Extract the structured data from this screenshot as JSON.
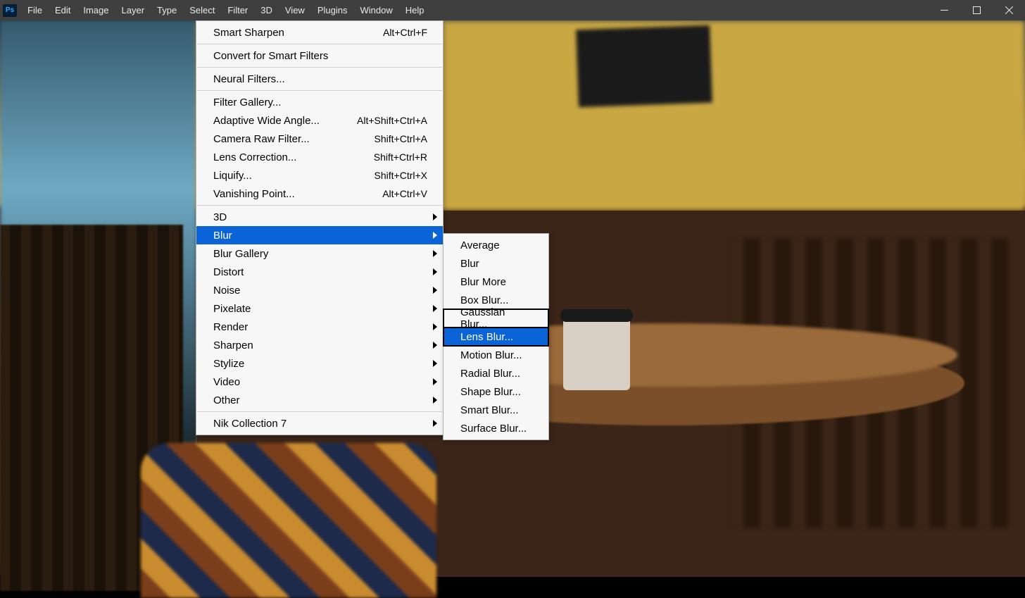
{
  "app_logo": "Ps",
  "menubar": [
    "File",
    "Edit",
    "Image",
    "Layer",
    "Type",
    "Select",
    "Filter",
    "3D",
    "View",
    "Plugins",
    "Window",
    "Help"
  ],
  "filter_menu": {
    "groups": [
      [
        {
          "label": "Smart Sharpen",
          "shortcut": "Alt+Ctrl+F",
          "arrow": false
        }
      ],
      [
        {
          "label": "Convert for Smart Filters",
          "shortcut": "",
          "arrow": false
        }
      ],
      [
        {
          "label": "Neural Filters...",
          "shortcut": "",
          "arrow": false
        }
      ],
      [
        {
          "label": "Filter Gallery...",
          "shortcut": "",
          "arrow": false
        },
        {
          "label": "Adaptive Wide Angle...",
          "shortcut": "Alt+Shift+Ctrl+A",
          "arrow": false
        },
        {
          "label": "Camera Raw Filter...",
          "shortcut": "Shift+Ctrl+A",
          "arrow": false
        },
        {
          "label": "Lens Correction...",
          "shortcut": "Shift+Ctrl+R",
          "arrow": false
        },
        {
          "label": "Liquify...",
          "shortcut": "Shift+Ctrl+X",
          "arrow": false
        },
        {
          "label": "Vanishing Point...",
          "shortcut": "Alt+Ctrl+V",
          "arrow": false
        }
      ],
      [
        {
          "label": "3D",
          "shortcut": "",
          "arrow": true
        },
        {
          "label": "Blur",
          "shortcut": "",
          "arrow": true,
          "highlight": true
        },
        {
          "label": "Blur Gallery",
          "shortcut": "",
          "arrow": true
        },
        {
          "label": "Distort",
          "shortcut": "",
          "arrow": true
        },
        {
          "label": "Noise",
          "shortcut": "",
          "arrow": true
        },
        {
          "label": "Pixelate",
          "shortcut": "",
          "arrow": true
        },
        {
          "label": "Render",
          "shortcut": "",
          "arrow": true
        },
        {
          "label": "Sharpen",
          "shortcut": "",
          "arrow": true
        },
        {
          "label": "Stylize",
          "shortcut": "",
          "arrow": true
        },
        {
          "label": "Video",
          "shortcut": "",
          "arrow": true
        },
        {
          "label": "Other",
          "shortcut": "",
          "arrow": true
        }
      ],
      [
        {
          "label": "Nik Collection 7",
          "shortcut": "",
          "arrow": true
        }
      ]
    ]
  },
  "blur_submenu": [
    {
      "label": "Average"
    },
    {
      "label": "Blur"
    },
    {
      "label": "Blur More"
    },
    {
      "label": "Box Blur..."
    },
    {
      "label": "Gaussian Blur...",
      "boxed": true
    },
    {
      "label": "Lens Blur...",
      "highlight": true,
      "boxed": true
    },
    {
      "label": "Motion Blur..."
    },
    {
      "label": "Radial Blur..."
    },
    {
      "label": "Shape Blur..."
    },
    {
      "label": "Smart Blur..."
    },
    {
      "label": "Surface Blur..."
    }
  ]
}
